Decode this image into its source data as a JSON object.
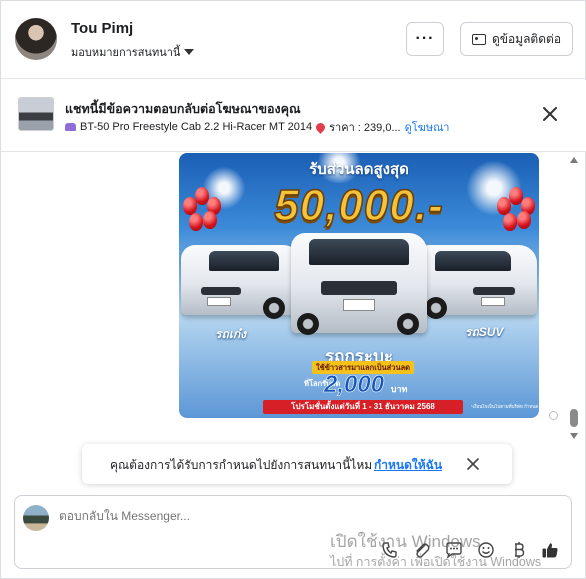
{
  "header": {
    "contact_name": "Tou Pimj",
    "assign_label": "มอบหมายการสนทนานี้",
    "more_label": "···",
    "contact_info_label": "ดูข้อมูลติดต่อ"
  },
  "ad_banner": {
    "title": "แชทนี้มีข้อความตอบกลับต่อโฆษณาของคุณ",
    "car_text": "BT-50 Pro Freestyle Cab 2.2 Hi-Racer MT 2014",
    "price_text": "ราคา : 239,0...",
    "view_ad_label": "ดูโฆษณา"
  },
  "promo_image": {
    "headline": "รับส่วนลดสูงสุด",
    "amount": "50,000.-",
    "left_category": "รถเก๋ง",
    "right_category": "รถSUV",
    "middle_category": "รถกระบะ",
    "strip_text": "ใช้ข้าวสารมาแลกเป็นส่วนลด",
    "small_text": "ที่โลกรับลด",
    "amount2": "2,000",
    "unit": "บาท",
    "date_text": "โปรโมชั่นตั้งแต่วันที่ 1 - 31 ธันวาคม 2568",
    "fine_print": "*เงื่อนไขเป็นไปตามที่บริษัท กำหนด"
  },
  "assign_toast": {
    "question": "คุณต้องการได้รับการกำหนดไปยังการสนทนานี้ไหม",
    "assign_me_label": "กำหนดให้ฉัน"
  },
  "composer": {
    "placeholder": "ตอบกลับใน Messenger..."
  },
  "toolbar_icons": [
    "phone-icon",
    "attach-icon",
    "chat-bubble-icon",
    "emoji-icon",
    "currency-baht-icon",
    "thumbs-up-icon"
  ],
  "os_watermark": {
    "line1": "เปิดใช้งาน Windows",
    "line2": "ไปที่ การตั้งค่า เพื่อเปิดใช้งาน Windows"
  },
  "colors": {
    "accent": "#1877f2",
    "border": "#ccd0d5",
    "text": "#1c1e21"
  }
}
